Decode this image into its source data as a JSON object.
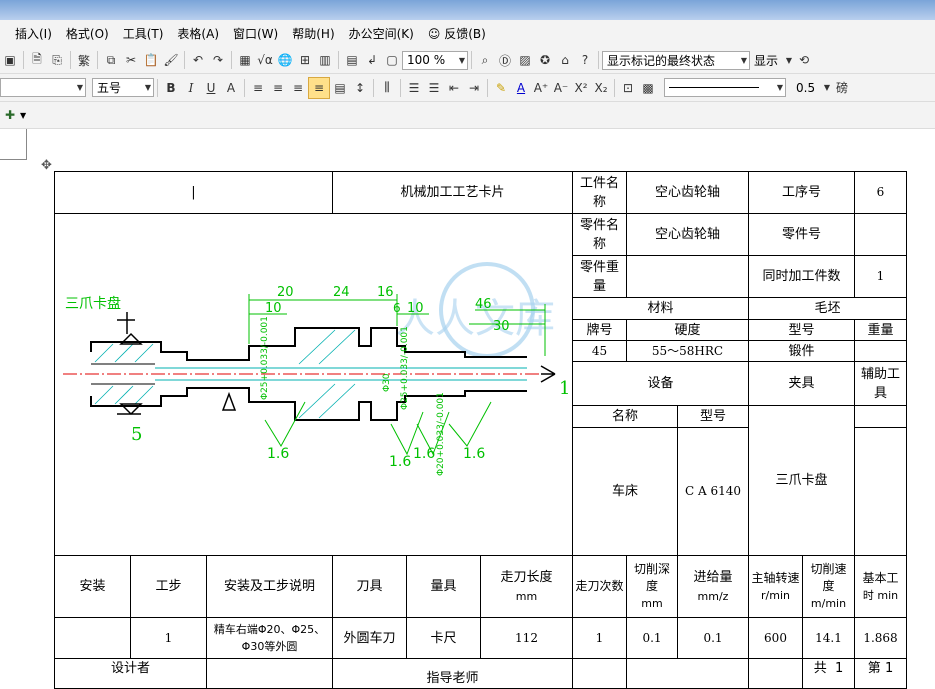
{
  "menubar": {
    "items": [
      "插入(I)",
      "格式(O)",
      "工具(T)",
      "表格(A)",
      "窗口(W)",
      "帮助(H)",
      "办公空间(K)",
      "反馈(B)"
    ]
  },
  "toolbar": {
    "traditional": "繁",
    "zoom": "100 %",
    "markup_state": "显示标记的最终状态",
    "show_label": "显示"
  },
  "format_bar": {
    "font_size": "五号",
    "line_width": "0.5",
    "line_unit": "磅"
  },
  "card": {
    "title": "机械加工工艺卡片",
    "workpiece_name_label": "工件名称",
    "workpiece_name": "空心齿轮轴",
    "process_no_label": "工序号",
    "process_no": "6",
    "part_name_label": "零件名称",
    "part_name": "空心齿轮轴",
    "part_no_label": "零件号",
    "part_weight_label": "零件重量",
    "simultaneous_label": "同时加工件数",
    "simultaneous": "1",
    "material_label": "材料",
    "blank_label": "毛坯",
    "grade_label": "牌号",
    "hardness_label": "硬度",
    "type_label": "型号",
    "weight_label": "重量",
    "grade": "45",
    "hardness": "55～58HRC",
    "blank_type": "锻件",
    "equipment_label": "设备",
    "fixture_label": "夹具",
    "aux_tool_label": "辅助工具",
    "name_label": "名称",
    "model_label": "型号",
    "equipment_name": "车床",
    "equipment_model": "C A 6140",
    "fixture": "三爪卡盘",
    "headers": {
      "install": "安装",
      "step": "工步",
      "description": "安装及工步说明",
      "tool": "刀具",
      "gauge": "量具",
      "cut_length": "走刀长度",
      "cut_length_unit": "mm",
      "passes": "走刀次数",
      "depth": "切削深度",
      "depth_unit": "mm",
      "feed": "进给量",
      "feed_unit": "mm/z",
      "speed": "主轴转速",
      "speed_unit": "r/min",
      "cut_speed": "切削速度",
      "cut_speed_unit": "m/min",
      "base_time": "基本工",
      "base_time_unit": "时 min"
    },
    "row": {
      "step": "1",
      "description": "精车右端Φ20、Φ25、Φ30等外圆",
      "tool": "外圆车刀",
      "gauge": "卡尺",
      "cut_length": "112",
      "passes": "1",
      "depth": "0.1",
      "feed": "0.1",
      "speed": "600",
      "cut_speed": "14.1",
      "base_time": "1.868"
    },
    "footer": {
      "designer": "设计者",
      "advisor": "指导老师",
      "total": "共",
      "total_n": "1",
      "page": "第",
      "page_n": "1"
    }
  },
  "drawing": {
    "chuck_label": "三爪卡盘",
    "dims": [
      "20",
      "24",
      "16",
      "10",
      "6",
      "10",
      "46",
      "30"
    ],
    "left_mark": "5",
    "right_mark": "1",
    "roughness": [
      "1.6",
      "1.6",
      "1.6",
      "1.6"
    ],
    "diam_labels": [
      "Φ25+0.033/-0.001",
      "Φ30",
      "Φ25+0.033/-0.001",
      "Φ20+0.033/-0.001"
    ],
    "watermark": "人人文库",
    "colors": {
      "green": "#00c000",
      "red": "#e00000",
      "cyan": "#00b0b0"
    }
  }
}
